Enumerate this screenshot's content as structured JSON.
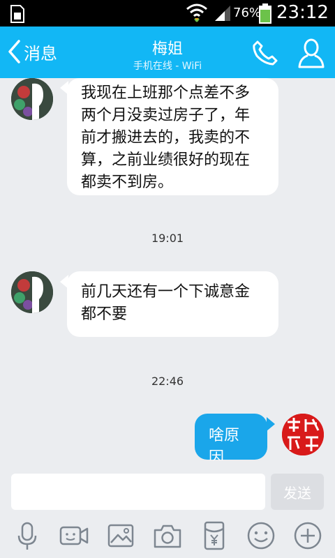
{
  "status_bar": {
    "battery_percent": "76%",
    "battery_level": 0.76,
    "time": "23:12"
  },
  "header": {
    "back_label": "消息",
    "contact_name": "梅姐",
    "contact_status": "手机在线 - WiFi"
  },
  "messages": [
    {
      "direction": "incoming",
      "text_lines": [
        "我现在上班那个点差不多",
        "两个月没卖过房子了，年",
        "前才搬进去的，我卖的不",
        "算，之前业绩很好的现在",
        "都卖不到房。"
      ]
    },
    {
      "type": "timestamp",
      "text": "19:01"
    },
    {
      "direction": "incoming",
      "text_lines": [
        "前几天还有一个下诚意金",
        "都不要"
      ]
    },
    {
      "type": "timestamp",
      "text": "22:46"
    },
    {
      "direction": "outgoing",
      "text": "啥原因"
    }
  ],
  "input": {
    "value": "",
    "send_label": "发送"
  },
  "toolbar": [
    "microphone-icon",
    "video-call-icon",
    "image-icon",
    "camera-icon",
    "red-packet-icon",
    "emoji-icon",
    "plus-icon"
  ],
  "colors": {
    "header": "#12b7f5",
    "outgoing_bubble": "#1aa6ea",
    "chat_bg": "#ebedf0"
  }
}
